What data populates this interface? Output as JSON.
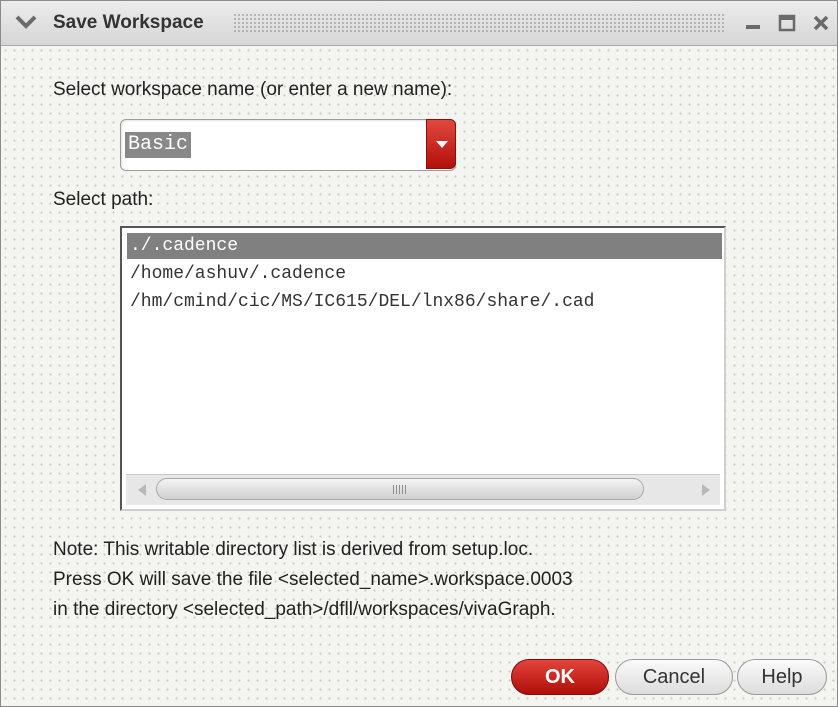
{
  "window": {
    "title": "Save Workspace",
    "icons": [
      "chevron-down-icon",
      "minimize-icon",
      "maximize-icon",
      "close-icon"
    ]
  },
  "name_section": {
    "label": "Select workspace name (or enter a new name):",
    "selected_value": "Basic"
  },
  "path_section": {
    "label": "Select path:",
    "items": [
      "./.cadence",
      "/home/ashuv/.cadence",
      "/hm/cmind/cic/MS/IC615/DEL/lnx86/share/.cad"
    ],
    "selected_index": 0
  },
  "note": {
    "line1": "Note: This writable directory list is derived from setup.loc.",
    "line2": "Press OK will save the file <selected_name>.workspace.0003",
    "line3": "in the directory <selected_path>/dfll/workspaces/vivaGraph."
  },
  "buttons": {
    "ok": "OK",
    "cancel": "Cancel",
    "help": "Help"
  },
  "colors": {
    "accent_red": "#c8201a",
    "selection_gray": "#808080"
  }
}
